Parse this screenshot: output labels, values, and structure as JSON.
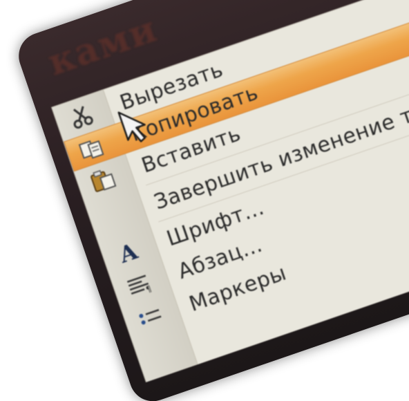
{
  "background": {
    "text": "ками"
  },
  "menu": {
    "items": [
      {
        "label": "Вырезать",
        "icon": "scissors-icon",
        "highlighted": false
      },
      {
        "label": "Копировать",
        "icon": "copy-icon",
        "highlighted": true
      },
      {
        "label": "Вставить",
        "icon": "paste-icon",
        "highlighted": false
      },
      {
        "label": "Завершить изменение текста",
        "icon": "",
        "highlighted": false
      },
      {
        "label": "Шрифт...",
        "icon": "font-icon",
        "highlighted": false
      },
      {
        "label": "Абзац...",
        "icon": "paragraph-icon",
        "highlighted": false
      },
      {
        "label": "Маркеры",
        "icon": "bullets-icon",
        "highlighted": false
      }
    ]
  },
  "colors": {
    "highlight": "#eea54a",
    "menu_bg": "#e9e7dd",
    "gutter": "#d6d3c8"
  }
}
